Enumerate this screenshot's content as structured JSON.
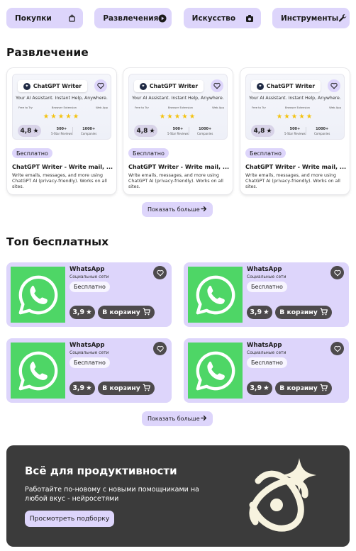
{
  "categories": [
    {
      "label": "Покупки",
      "icon": "shopping-bag-icon"
    },
    {
      "label": "Развлечения",
      "icon": "play-circle-icon"
    },
    {
      "label": "Искусство",
      "icon": "palette-box-icon"
    },
    {
      "label": "Инструменты",
      "icon": "wrench-icon"
    }
  ],
  "entertainment": {
    "heading": "Развлечение",
    "cards": [
      {
        "thumb_title": "ChatGPT Writer",
        "thumb_tagline": "Your AI Assistant. Instant Help, Anywhere.",
        "features": [
          "Free to Try",
          "Browser Extension",
          "Web App"
        ],
        "rating": "4,8",
        "stat1_value": "500+",
        "stat1_label": "5-Star Reviews",
        "stat2_value": "1000+",
        "stat2_label": "Companies",
        "badge": "Бесплатно",
        "title": "ChatGPT Writer - Write mail, ...",
        "description": "Write emails, messages, and more using ChatGPT AI (privacy-friendly). Works on all sites."
      },
      {
        "thumb_title": "ChatGPT Writer",
        "thumb_tagline": "Your AI Assistant. Instant Help, Anywhere.",
        "features": [
          "Free to Try",
          "Browser Extension",
          "Web App"
        ],
        "rating": "4,8",
        "stat1_value": "500+",
        "stat1_label": "5-Star Reviews",
        "stat2_value": "1000+",
        "stat2_label": "Companies",
        "badge": "Бесплатно",
        "title": "ChatGPT Writer - Write mail, ...",
        "description": "Write emails, messages, and more using ChatGPT AI (privacy-friendly). Works on all sites."
      },
      {
        "thumb_title": "ChatGPT Writer",
        "thumb_tagline": "Your AI Assistant. Instant Help, Anywhere.",
        "features": [
          "Free to Try",
          "Browser Extension",
          "Web App"
        ],
        "rating": "4,8",
        "stat1_value": "500+",
        "stat1_label": "5-Star Reviews",
        "stat2_value": "1000+",
        "stat2_label": "Companies",
        "badge": "Бесплатно",
        "title": "ChatGPT Writer - Write mail, ...",
        "description": "Write emails, messages, and more using ChatGPT AI (privacy-friendly). Works on all sites."
      }
    ],
    "more_label": "Показать больше"
  },
  "top_free": {
    "heading": "Топ бесплатных",
    "cards": [
      {
        "name": "WhatsApp",
        "category": "Социальные сети",
        "badge": "Бесплатно",
        "rating": "3,9",
        "cart_label": "В корзину"
      },
      {
        "name": "WhatsApp",
        "category": "Социальные сети",
        "badge": "Бесплатно",
        "rating": "3,9",
        "cart_label": "В корзину"
      },
      {
        "name": "WhatsApp",
        "category": "Социальные сети",
        "badge": "Бесплатно",
        "rating": "3,9",
        "cart_label": "В корзину"
      },
      {
        "name": "WhatsApp",
        "category": "Социальные сети",
        "badge": "Бесплатно",
        "rating": "3,9",
        "cart_label": "В корзину"
      }
    ],
    "more_label": "Показать больше"
  },
  "promo": {
    "title": "Всё для продуктивности",
    "text": "Работайте по-новому с новыми помощниками на любой вкус - нейросетями",
    "button_label": "Просмотреть подборку",
    "illustration_icon": "atom-sparkle-icon"
  },
  "colors": {
    "accent": "#ddd5fb",
    "dark_pill": "#4d4a4c",
    "whatsapp_green": "#4ed666",
    "banner_bg": "#3b3b3b",
    "star": "#f4c20d"
  }
}
